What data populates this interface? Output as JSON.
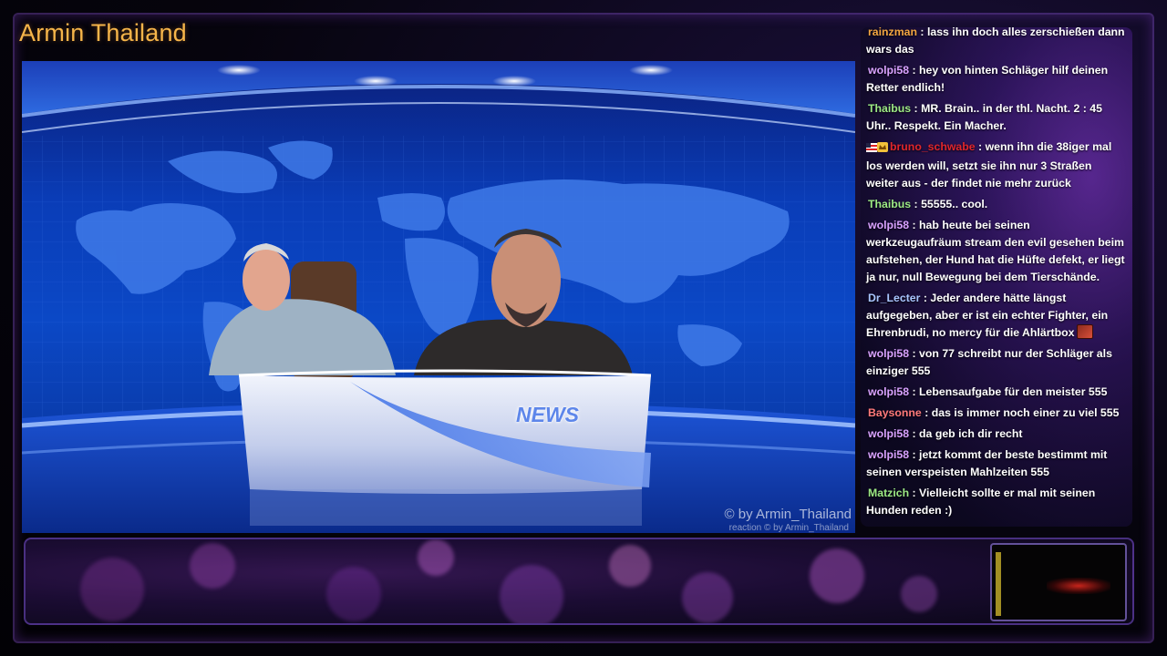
{
  "channel": {
    "title": "Armin Thailand"
  },
  "video": {
    "desk_text": "NEWS",
    "watermark": "© by Armin_Thailand",
    "watermark_small": "reaction  © by Armin_Thailand"
  },
  "chat": {
    "messages": [
      {
        "user": "rainzman",
        "color": "#f3a641",
        "text": "lass ihn doch alles zerschießen dann wars das"
      },
      {
        "user": "wolpi58",
        "color": "#d9a2ff",
        "text": "hey von hinten Schläger hilf deinen Retter endlich!"
      },
      {
        "user": "Thaibus",
        "color": "#9dea84",
        "text": "MR. Brain.. in der thl. Nacht. 2 : 45 Uhr.. Respekt. Ein Macher."
      },
      {
        "user": "bruno_schwabe",
        "color": "#e0262b",
        "text": "wenn ihn die 38iger mal los werden will, setzt sie ihn nur 3 Straßen weiter aus - der findet nie mehr zurück",
        "badges": [
          "flag-badge",
          "crown-badge"
        ]
      },
      {
        "user": "Thaibus",
        "color": "#9dea84",
        "text": "55555.. cool."
      },
      {
        "user": "wolpi58",
        "color": "#d9a2ff",
        "text": "hab heute bei seinen werkzeugaufräum stream den evil gesehen beim aufstehen, der Hund hat die Hüfte defekt, er liegt ja nur, null Bewegung bei dem Tierschände."
      },
      {
        "user": "Dr_Lecter",
        "color": "#a9c6ff",
        "text": "Jeder andere hätte längst aufgegeben, aber er ist ein echter Fighter, ein Ehrenbrudi, no mercy für die Ahlärtbox",
        "emote": "emote-icon"
      },
      {
        "user": "wolpi58",
        "color": "#d9a2ff",
        "text": "von 77 schreibt nur der Schläger als einziger 555"
      },
      {
        "user": "wolpi58",
        "color": "#d9a2ff",
        "text": "Lebensaufgabe für den meister 555"
      },
      {
        "user": "Baysonne",
        "color": "#ff7a7a",
        "text": "das is immer noch einer zu viel 555"
      },
      {
        "user": "wolpi58",
        "color": "#d9a2ff",
        "text": "da geb ich dir recht"
      },
      {
        "user": "wolpi58",
        "color": "#d9a2ff",
        "text": "jetzt kommt der beste bestimmt mit seinen verspeisten Mahlzeiten 555"
      },
      {
        "user": "Matzich",
        "color": "#9dea84",
        "text": "Vielleicht sollte er mal mit seinen Hunden reden :)"
      }
    ]
  },
  "colors": {
    "title": "#f6b54a",
    "studio_blue": "#0b48c6",
    "chat_panel": "#3c1978",
    "frame_purple": "#8c46dc"
  }
}
